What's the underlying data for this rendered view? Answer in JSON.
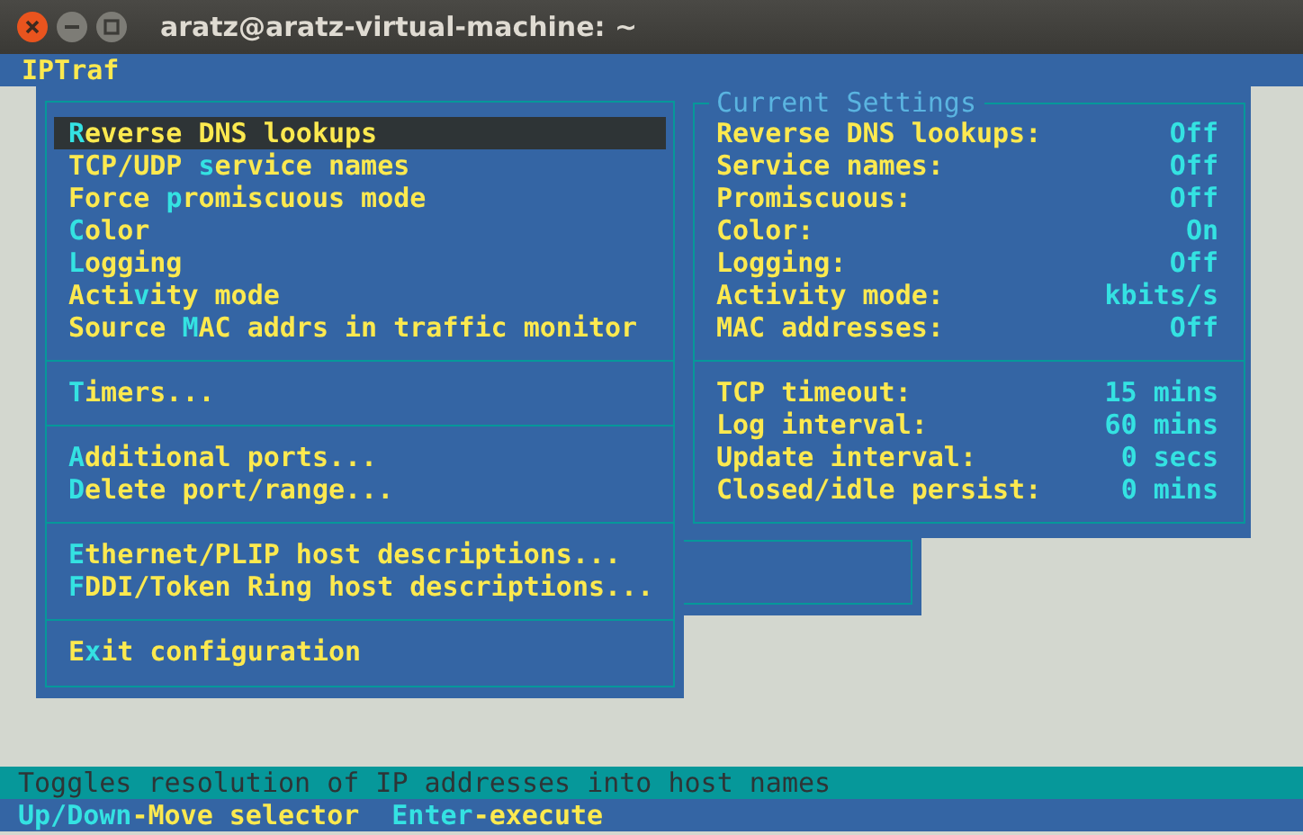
{
  "window": {
    "title": "aratz@aratz-virtual-machine: ~"
  },
  "app_bar": {
    "title": "IPTraf"
  },
  "menu": {
    "sections": [
      {
        "items": [
          {
            "hotkey": "R",
            "after": "everse DNS lookups",
            "selected": true
          },
          {
            "before": "TCP/UDP ",
            "hotkey": "s",
            "after": "ervice names",
            "selected": false
          },
          {
            "before": "Force ",
            "hotkey": "p",
            "after": "romiscuous mode",
            "selected": false
          },
          {
            "hotkey": "C",
            "after": "olor",
            "selected": false
          },
          {
            "hotkey": "L",
            "after": "ogging",
            "selected": false
          },
          {
            "before": "Acti",
            "hotkey": "v",
            "after": "ity mode",
            "selected": false
          },
          {
            "before": "Source ",
            "hotkey": "M",
            "after": "AC addrs in traffic monitor",
            "selected": false
          }
        ]
      },
      {
        "items": [
          {
            "hotkey": "T",
            "after": "imers...",
            "selected": false
          }
        ]
      },
      {
        "items": [
          {
            "hotkey": "A",
            "after": "dditional ports...",
            "selected": false
          },
          {
            "hotkey": "D",
            "after": "elete port/range...",
            "selected": false
          }
        ]
      },
      {
        "items": [
          {
            "hotkey": "E",
            "after": "thernet/PLIP host descriptions...",
            "selected": false
          },
          {
            "hotkey": "F",
            "after": "DDI/Token Ring host descriptions...",
            "selected": false
          }
        ]
      },
      {
        "items": [
          {
            "before": "E",
            "hotkey": "x",
            "after": "it configuration",
            "selected": false
          }
        ]
      }
    ]
  },
  "current_settings": {
    "title": "Current Settings",
    "groups": [
      [
        {
          "label": "Reverse DNS lookups:",
          "value": "Off"
        },
        {
          "label": "Service names:",
          "value": "Off"
        },
        {
          "label": "Promiscuous:",
          "value": "Off"
        },
        {
          "label": "Color:",
          "value": "On"
        },
        {
          "label": "Logging:",
          "value": "Off"
        },
        {
          "label": "Activity mode:",
          "value": "kbits/s"
        },
        {
          "label": "MAC addresses:",
          "value": "Off"
        }
      ],
      [
        {
          "label": "TCP timeout:",
          "value": "15 mins"
        },
        {
          "label": "Log interval:",
          "value": "60 mins"
        },
        {
          "label": "Update interval:",
          "value": "0 secs"
        },
        {
          "label": "Closed/idle persist:",
          "value": "0 mins"
        }
      ]
    ]
  },
  "status_bar": {
    "description": "Toggles resolution of IP addresses into host names",
    "hints": [
      {
        "key": "Up/Down",
        "action": "-Move selector"
      },
      {
        "key": "Enter",
        "action": "-execute"
      }
    ]
  }
}
